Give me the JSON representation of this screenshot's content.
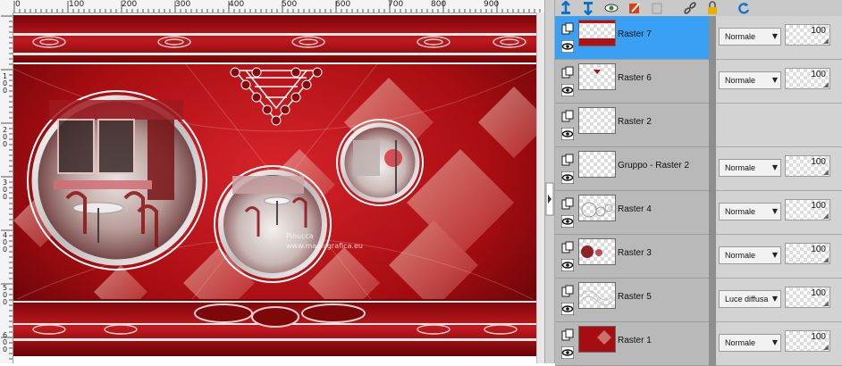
{
  "ruler_top": {
    "labels": [
      "0",
      "100",
      "200",
      "300",
      "400",
      "500",
      "600",
      "700",
      "800",
      "900"
    ]
  },
  "ruler_left": {
    "labels": [
      "1\n0\n0",
      "2\n0\n0",
      "3\n0\n0",
      "4\n0\n0",
      "5\n0\n0",
      "6\n0\n0"
    ]
  },
  "canvas": {
    "watermark": "Pinucca\nwww.magicgrafica.eu",
    "accent": "#b01016"
  },
  "toolbar": {
    "icons": [
      "new-raster-layer-icon",
      "merge-down-icon",
      "mask-eye-icon",
      "edit-layer-icon",
      "delete-layer-icon",
      "link-icon",
      "lock-icon",
      "refresh-icon"
    ]
  },
  "layers": [
    {
      "name": "Raster 7",
      "blend": "Normale",
      "opacity": "100",
      "selected": true,
      "thumb": "raster7"
    },
    {
      "name": "Raster 6",
      "blend": "Normale",
      "opacity": "100",
      "selected": false,
      "thumb": "raster6"
    },
    {
      "name": "Raster 2",
      "blend": "",
      "opacity": "",
      "selected": false,
      "thumb": "empty"
    },
    {
      "name": "Gruppo - Raster 2",
      "blend": "Normale",
      "opacity": "100",
      "selected": false,
      "thumb": "group"
    },
    {
      "name": "Raster 4",
      "blend": "Normale",
      "opacity": "100",
      "selected": false,
      "thumb": "raster4"
    },
    {
      "name": "Raster 3",
      "blend": "Normale",
      "opacity": "100",
      "selected": false,
      "thumb": "raster3"
    },
    {
      "name": "Raster 5",
      "blend": "Luce diffusa",
      "opacity": "100",
      "selected": false,
      "thumb": "raster5"
    },
    {
      "name": "Raster 1",
      "blend": "Normale",
      "opacity": "100",
      "selected": false,
      "thumb": "raster1"
    }
  ],
  "colors": {
    "selected_row": "#3aa0f4",
    "panel_bg": "#c9c9c9",
    "row_bg": "#b9b9b9"
  }
}
